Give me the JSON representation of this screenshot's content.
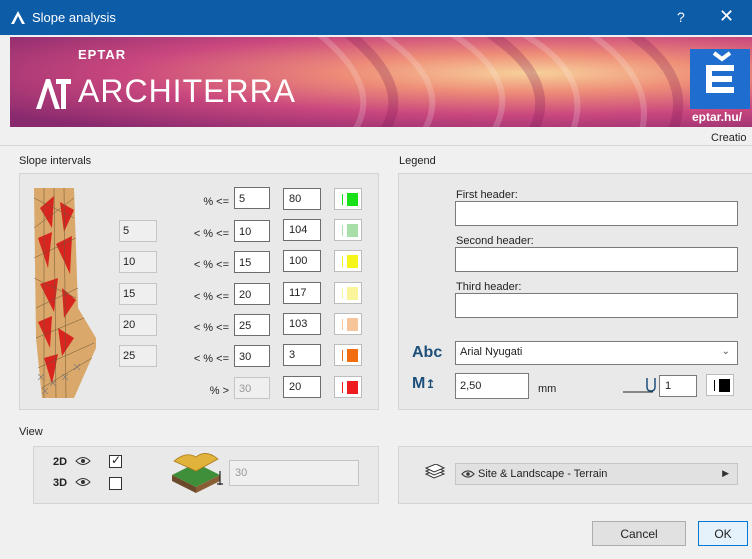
{
  "window": {
    "title": "Slope analysis",
    "help": "?",
    "close": "✕"
  },
  "banner": {
    "company": "EPTAR",
    "product": "ARCHITERRA",
    "site": "eptar.hu/"
  },
  "tab_partial": "Creatio",
  "slope_intervals": {
    "label": "Slope intervals",
    "rows": [
      {
        "lower": "",
        "op": "% <=",
        "upper": "5",
        "pen": "80",
        "color": "#19e019"
      },
      {
        "lower": "5",
        "op": "< % <=",
        "upper": "10",
        "pen": "104",
        "color": "#a8dfa8"
      },
      {
        "lower": "10",
        "op": "< % <=",
        "upper": "15",
        "pen": "100",
        "color": "#f5f51a"
      },
      {
        "lower": "15",
        "op": "< % <=",
        "upper": "20",
        "pen": "117",
        "color": "#faf59a"
      },
      {
        "lower": "20",
        "op": "< % <=",
        "upper": "25",
        "pen": "103",
        "color": "#f7c59a"
      },
      {
        "lower": "25",
        "op": "< % <=",
        "upper": "30",
        "pen": "3",
        "color": "#f26d10"
      },
      {
        "lower": "",
        "op": "% >",
        "upper": "30",
        "pen": "20",
        "color": "#ee1c1c"
      }
    ]
  },
  "legend": {
    "label": "Legend",
    "first_header": {
      "label": "First header:",
      "value": ""
    },
    "second_header": {
      "label": "Second header:",
      "value": ""
    },
    "third_header": {
      "label": "Third header:",
      "value": ""
    },
    "font_icon": "Abc",
    "font": "Arial Nyugati",
    "size_icon": "M",
    "size": "2,50",
    "unit": "mm",
    "pen": "1"
  },
  "view": {
    "label": "View",
    "label_2d": "2D",
    "label_3d": "3D",
    "checked_2d": true,
    "checked_3d": false,
    "terrain_value": "30"
  },
  "layer": {
    "value": "Site & Landscape - Terrain"
  },
  "buttons": {
    "cancel": "Cancel",
    "ok": "OK"
  }
}
